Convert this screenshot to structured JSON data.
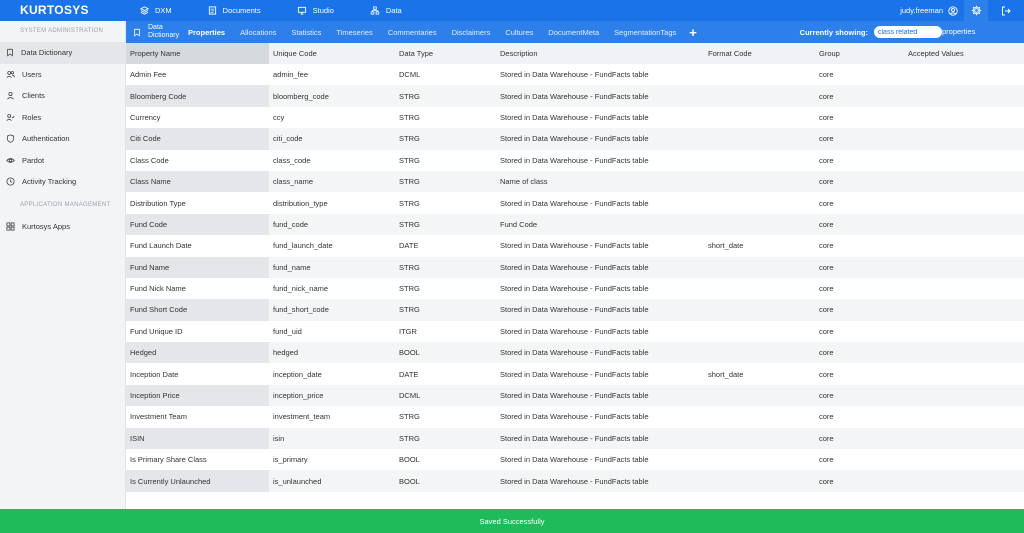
{
  "app": {
    "logo": "KURTOSYS"
  },
  "topnav": [
    {
      "label": "DXM",
      "icon": "layers-icon"
    },
    {
      "label": "Documents",
      "icon": "document-icon"
    },
    {
      "label": "Studio",
      "icon": "monitor-icon"
    },
    {
      "label": "Data",
      "icon": "network-icon"
    }
  ],
  "user": {
    "name": "judy.freeman"
  },
  "sidebar": {
    "section1": "SYSTEM ADMINISTRATION",
    "items": [
      {
        "label": "Data Dictionary",
        "icon": "bookmark-icon",
        "active": true
      },
      {
        "label": "Users",
        "icon": "users-icon"
      },
      {
        "label": "Clients",
        "icon": "clients-icon"
      },
      {
        "label": "Roles",
        "icon": "roles-icon"
      },
      {
        "label": "Authentication",
        "icon": "shield-icon"
      },
      {
        "label": "Pardot",
        "icon": "eye-icon"
      },
      {
        "label": "Activity Tracking",
        "icon": "clock-icon"
      }
    ],
    "section2": "APPLICATION MANAGEMENT",
    "items2": [
      {
        "label": "Kurtosys Apps",
        "icon": "grid-icon"
      }
    ]
  },
  "subnav": {
    "dropdown_label": "Data Dictionary",
    "tabs": [
      "Properties",
      "Allocations",
      "Statistics",
      "Timeseries",
      "Commentaries",
      "Disclaimers",
      "Cultures",
      "DocumentMeta",
      "SegmentationTags"
    ],
    "add": "+",
    "showing_label": "Currently showing:",
    "showing_value": "class related",
    "showing_suffix": "properties"
  },
  "table": {
    "headers": [
      "Property Name",
      "Unique Code",
      "Data Type",
      "Description",
      "Format Code",
      "Group",
      "Accepted Values"
    ],
    "rows": [
      [
        "Admin Fee",
        "admin_fee",
        "DCML",
        "Stored in Data Warehouse - FundFacts table",
        "",
        "core",
        ""
      ],
      [
        "Bloomberg Code",
        "bloomberg_code",
        "STRG",
        "Stored in Data Warehouse - FundFacts table",
        "",
        "core",
        ""
      ],
      [
        "Currency",
        "ccy",
        "STRG",
        "Stored in Data Warehouse - FundFacts table",
        "",
        "core",
        ""
      ],
      [
        "Citi Code",
        "citi_code",
        "STRG",
        "Stored in Data Warehouse - FundFacts table",
        "",
        "core",
        ""
      ],
      [
        "Class Code",
        "class_code",
        "STRG",
        "Stored in Data Warehouse - FundFacts table",
        "",
        "core",
        ""
      ],
      [
        "Class Name",
        "class_name",
        "STRG",
        "Name of class",
        "",
        "core",
        ""
      ],
      [
        "Distribution Type",
        "distribution_type",
        "STRG",
        "Stored in Data Warehouse - FundFacts table",
        "",
        "core",
        ""
      ],
      [
        "Fund Code",
        "fund_code",
        "STRG",
        "Fund Code",
        "",
        "core",
        ""
      ],
      [
        "Fund Launch Date",
        "fund_launch_date",
        "DATE",
        "Stored in Data Warehouse - FundFacts table",
        "short_date",
        "core",
        ""
      ],
      [
        "Fund Name",
        "fund_name",
        "STRG",
        "Stored in Data Warehouse - FundFacts table",
        "",
        "core",
        ""
      ],
      [
        "Fund Nick Name",
        "fund_nick_name",
        "STRG",
        "Stored in Data Warehouse - FundFacts table",
        "",
        "core",
        ""
      ],
      [
        "Fund Short Code",
        "fund_short_code",
        "STRG",
        "Stored in Data Warehouse - FundFacts table",
        "",
        "core",
        ""
      ],
      [
        "Fund Unique ID",
        "fund_uid",
        "ITGR",
        "Stored in Data Warehouse - FundFacts table",
        "",
        "core",
        ""
      ],
      [
        "Hedged",
        "hedged",
        "BOOL",
        "Stored in Data Warehouse - FundFacts table",
        "",
        "core",
        ""
      ],
      [
        "Inception Date",
        "inception_date",
        "DATE",
        "Stored in Data Warehouse - FundFacts table",
        "short_date",
        "core",
        ""
      ],
      [
        "Inception Price",
        "inception_price",
        "DCML",
        "Stored in Data Warehouse - FundFacts table",
        "",
        "core",
        ""
      ],
      [
        "Investment Team",
        "investment_team",
        "STRG",
        "Stored in Data Warehouse - FundFacts table",
        "",
        "core",
        ""
      ],
      [
        "ISIN",
        "isin",
        "STRG",
        "Stored in Data Warehouse - FundFacts table",
        "",
        "core",
        ""
      ],
      [
        "Is Primary Share Class",
        "is_primary",
        "BOOL",
        "Stored in Data Warehouse - FundFacts table",
        "",
        "core",
        ""
      ],
      [
        "Is Currently Unlaunched",
        "is_unlaunched",
        "BOOL",
        "Stored in Data Warehouse - FundFacts table",
        "",
        "core",
        ""
      ]
    ]
  },
  "toast": {
    "message": "Saved Successfully"
  },
  "colors": {
    "primary": "#1a73e8",
    "subnav": "#2d7fea",
    "success": "#1fba5a"
  }
}
